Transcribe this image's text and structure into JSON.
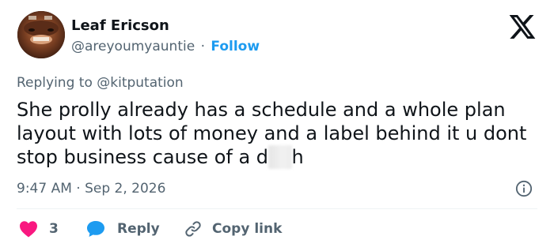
{
  "author": {
    "name": "Leaf Ericson",
    "handle": "@areyoumyauntie",
    "separator": "·",
    "follow_label": "Follow"
  },
  "reply_context": {
    "prefix": "Replying to",
    "mention": "@kitputation"
  },
  "tweet": {
    "text_before": "She prolly already has a schedule and a whole plan layout with lots of money and a label behind it u dont stop business cause of a d",
    "text_blurred": "ea",
    "text_after": "h"
  },
  "meta": {
    "time": "9:47 AM",
    "separator": "·",
    "date": "Sep 2, 2026"
  },
  "actions": {
    "like_count": "3",
    "reply_label": "Reply",
    "copy_link_label": "Copy link"
  },
  "colors": {
    "accent": "#1d9bf0",
    "like": "#f91880",
    "secondary_text": "#536471",
    "primary_text": "#0f1419"
  },
  "icons": [
    "x-logo-icon",
    "info-icon",
    "heart-icon",
    "reply-bubble-icon",
    "link-icon"
  ]
}
